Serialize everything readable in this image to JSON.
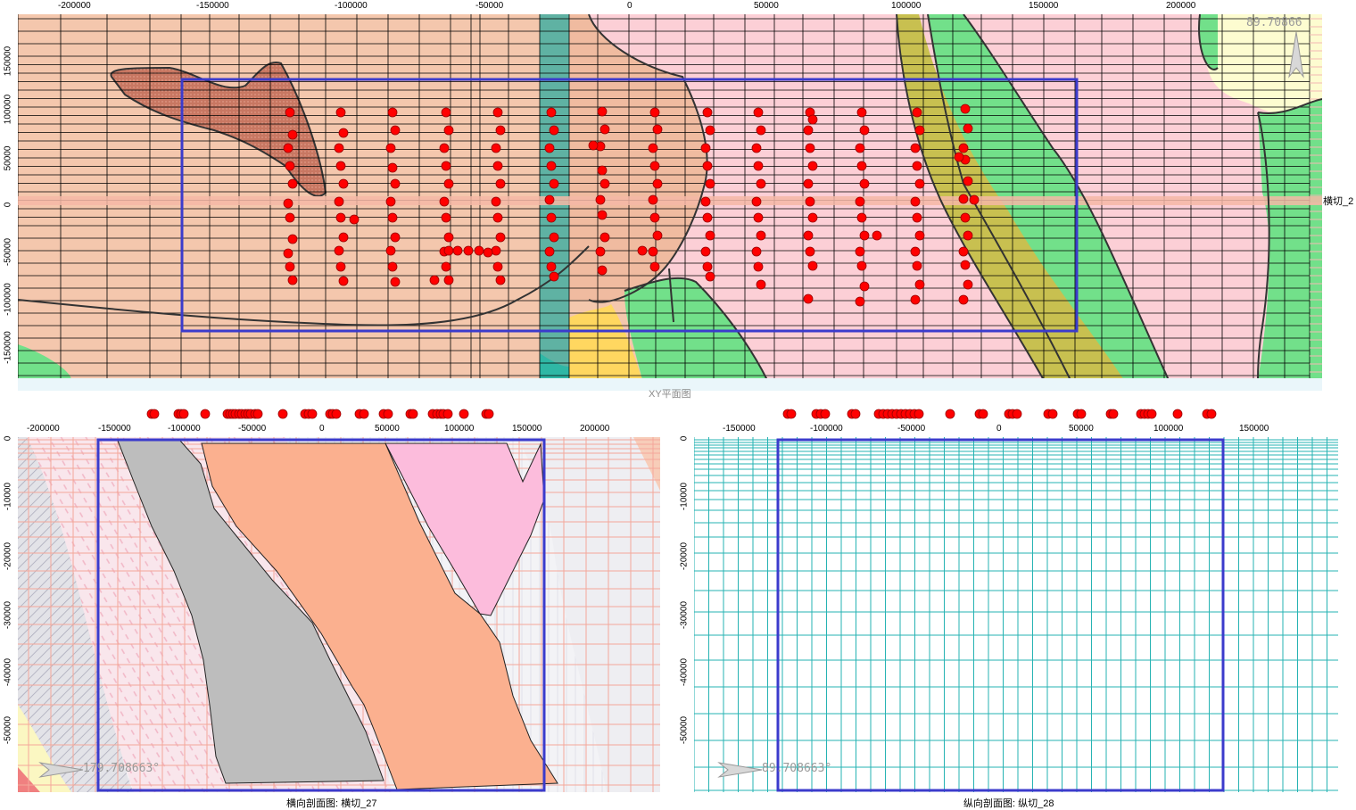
{
  "xy_panel": {
    "caption": "XY平面图",
    "angle": "89.70866",
    "side_label": "横切_2",
    "x_ticks": [
      "-200000",
      "-150000",
      "-100000",
      "-50000",
      "0",
      "50000",
      "100000",
      "150000",
      "200000"
    ],
    "y_ticks": [
      "150000",
      "100000",
      "50000",
      "0",
      "-50000",
      "-100000",
      "-150000"
    ],
    "colors": {
      "frame": "#3b3bcc",
      "points": "#ff0000",
      "strike_band": "#f5b7a6"
    }
  },
  "transverse_panel": {
    "caption": "横向剖面图: 横切_27",
    "angle": "179.708663°",
    "x_ticks": [
      "-200000",
      "-150000",
      "-100000",
      "-50000",
      "0",
      "50000",
      "100000",
      "150000",
      "200000"
    ],
    "y_ticks": [
      "0",
      "-10000",
      "-20000",
      "-30000",
      "-40000",
      "-50000"
    ],
    "colors": {
      "grid": "#f4a79a",
      "frame": "#3b3bcc"
    }
  },
  "longitudinal_panel": {
    "caption": "纵向剖面图: 纵切_28",
    "angle": "89.708663°",
    "x_ticks": [
      "-150000",
      "-100000",
      "-50000",
      "0",
      "50000",
      "100000",
      "150000"
    ],
    "y_ticks": [
      "0",
      "-10000",
      "-20000",
      "-30000",
      "-40000",
      "-50000"
    ],
    "colors": {
      "grid": "#26b3b3",
      "frame": "#3b3bcc"
    }
  }
}
